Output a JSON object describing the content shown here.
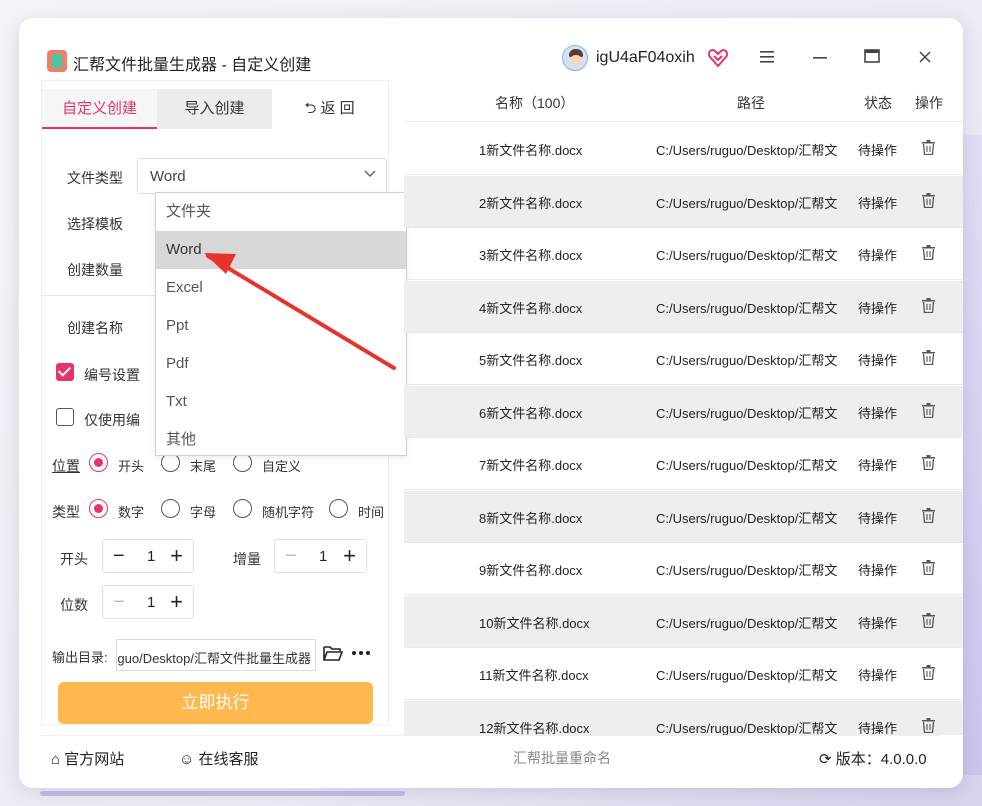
{
  "window": {
    "title": "汇帮文件批量生成器 - 自定义创建",
    "username": "igU4aF04oxih"
  },
  "tabs": {
    "custom": "自定义创建",
    "import": "导入创建",
    "back": "返 回"
  },
  "form": {
    "file_type_label": "文件类型",
    "file_type_value": "Word",
    "template_label": "选择模板",
    "count_label": "创建数量",
    "name_label": "创建名称",
    "numbering_label": "编号设置",
    "numbering_checked": true,
    "only_use_label": "仅使用编",
    "only_use_checked": false,
    "position_label": "位置",
    "position_options": [
      "开头",
      "末尾",
      "自定义"
    ],
    "position_selected": "开头",
    "type_label": "类型",
    "type_options": [
      "数字",
      "字母",
      "随机字符",
      "时间"
    ],
    "type_selected": "数字",
    "start_label": "开头",
    "start_value": "1",
    "increment_label": "增量",
    "increment_value": "1",
    "digits_label": "位数",
    "digits_value": "1",
    "output_label": "输出目录:",
    "output_value": "guo/Desktop/汇帮文件批量生成器",
    "execute_label": "立即执行"
  },
  "dropdown": {
    "options": [
      "文件夹",
      "Word",
      "Excel",
      "Ppt",
      "Pdf",
      "Txt",
      "其他"
    ],
    "selected": "Word"
  },
  "table": {
    "headers": {
      "name": "名称（100）",
      "path": "路径",
      "status": "状态",
      "action": "操作"
    },
    "rows": [
      {
        "name": "1新文件名称.docx",
        "path": "C:/Users/ruguo/Desktop/汇帮文",
        "status": "待操作"
      },
      {
        "name": "2新文件名称.docx",
        "path": "C:/Users/ruguo/Desktop/汇帮文",
        "status": "待操作"
      },
      {
        "name": "3新文件名称.docx",
        "path": "C:/Users/ruguo/Desktop/汇帮文",
        "status": "待操作"
      },
      {
        "name": "4新文件名称.docx",
        "path": "C:/Users/ruguo/Desktop/汇帮文",
        "status": "待操作"
      },
      {
        "name": "5新文件名称.docx",
        "path": "C:/Users/ruguo/Desktop/汇帮文",
        "status": "待操作"
      },
      {
        "name": "6新文件名称.docx",
        "path": "C:/Users/ruguo/Desktop/汇帮文",
        "status": "待操作"
      },
      {
        "name": "7新文件名称.docx",
        "path": "C:/Users/ruguo/Desktop/汇帮文",
        "status": "待操作"
      },
      {
        "name": "8新文件名称.docx",
        "path": "C:/Users/ruguo/Desktop/汇帮文",
        "status": "待操作"
      },
      {
        "name": "9新文件名称.docx",
        "path": "C:/Users/ruguo/Desktop/汇帮文",
        "status": "待操作"
      },
      {
        "name": "10新文件名称.docx",
        "path": "C:/Users/ruguo/Desktop/汇帮文",
        "status": "待操作"
      },
      {
        "name": "11新文件名称.docx",
        "path": "C:/Users/ruguo/Desktop/汇帮文",
        "status": "待操作"
      },
      {
        "name": "12新文件名称.docx",
        "path": "C:/Users/ruguo/Desktop/汇帮文",
        "status": "待操作"
      }
    ]
  },
  "footer": {
    "website": "官方网站",
    "support": "在线客服",
    "center": "汇帮批量重命名",
    "version": "版本：4.0.0.0"
  },
  "colors": {
    "accent": "#e4346a",
    "execute": "#ffb84d",
    "arrow": "#e8332a"
  }
}
